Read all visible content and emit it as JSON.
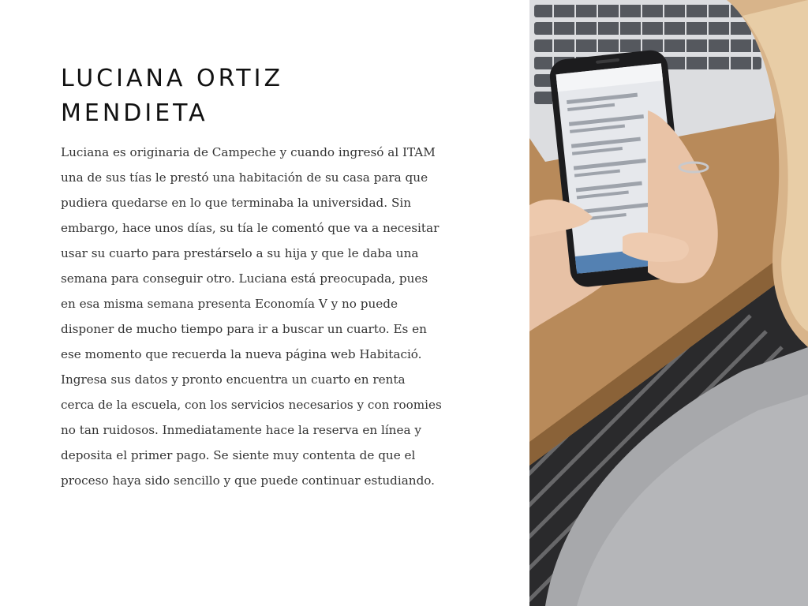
{
  "title": {
    "line1": "LUCIANA ORTIZ",
    "line2": "MENDIETA"
  },
  "body": {
    "lines": [
      "Luciana es originaria de Campeche y cuando  ingresó al ITAM",
      "una de sus tías le prestó una habitación de su casa para que",
      "pudiera quedarse en lo que terminaba la universidad. Sin",
      "embargo, hace unos días, su tía le comentó que va a necesitar",
      "usar su cuarto para prestárselo a su hija y que le daba una",
      "semana para conseguir otro. Luciana está preocupada, pues",
      "en esa misma semana presenta Economía V y no puede",
      "disponer de mucho tiempo para ir a buscar un cuarto. Es en",
      "ese momento que recuerda la nueva página web  Habitació.",
      "Ingresa sus datos y pronto encuentra un cuarto en renta",
      "cerca de la escuela, con los servicios necesarios y con roomies",
      "no tan ruidosos. Inmediatamente hace la reserva en línea y",
      "deposita el primer pago. Se siente muy contenta de que el",
      "proceso haya sido sencillo y que puede continuar estudiando."
    ]
  },
  "photo": {
    "subject": "woman-holding-smartphone-near-laptop"
  },
  "colors": {
    "title": "#111111",
    "body": "#333333",
    "background": "#ffffff"
  }
}
